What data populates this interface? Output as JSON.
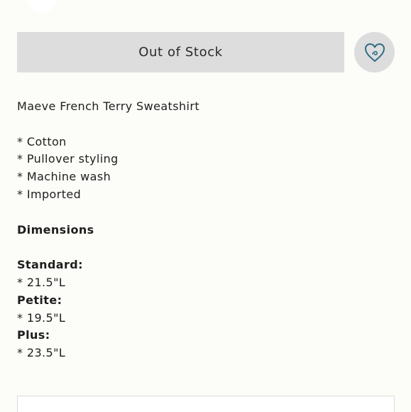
{
  "actions": {
    "stock_label": "Out of Stock",
    "favorite_icon": "heart-outline-icon",
    "favorite_color": "#2f6d86"
  },
  "description": {
    "title": "Maeve French Terry Sweatshirt",
    "features": [
      "* Cotton",
      "* Pullover styling",
      "* Machine wash",
      "* Imported"
    ],
    "dimensions_heading": "Dimensions",
    "sizes": [
      {
        "label": "Standard:",
        "value": "* 21.5\"L"
      },
      {
        "label": "Petite:",
        "value": "* 19.5\"L"
      },
      {
        "label": "Plus:",
        "value": "* 23.5\"L"
      }
    ]
  }
}
